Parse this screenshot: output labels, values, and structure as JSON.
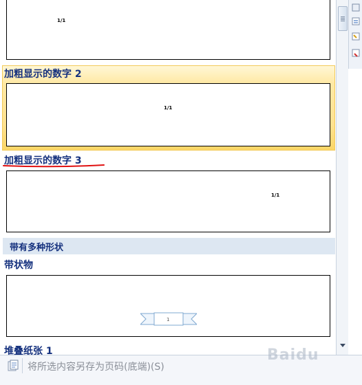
{
  "gallery": {
    "items": [
      {
        "title": "",
        "page_number": "1/1"
      },
      {
        "title": "加粗显示的数字 2",
        "page_number": "1/1"
      },
      {
        "title": "加粗显示的数字 3",
        "page_number": "1/1"
      },
      {
        "title": "带状物",
        "page_number": "1"
      },
      {
        "title": "堆叠纸张 1"
      }
    ],
    "sections": [
      {
        "title": "带有多种形状"
      }
    ],
    "selected_index": 1
  },
  "footer": {
    "save_label": "将所选内容另存为页码(底端)(S)"
  },
  "watermark": "Baidu",
  "colors": {
    "title_blue": "#15317e",
    "hover_yellow": "#ffe290",
    "section_bg": "#dde7f2",
    "annotation_red": "#e01010"
  },
  "icons": [
    "scroll-thumb-grip-icon",
    "scroll-down-arrow-icon",
    "save-selection-icon",
    "ribbon-icon"
  ]
}
